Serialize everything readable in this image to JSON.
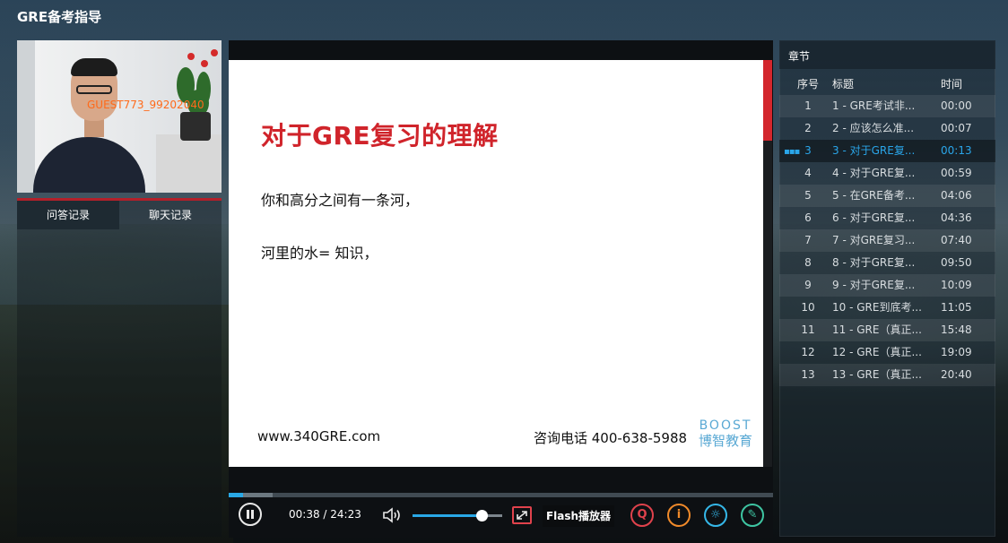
{
  "app": {
    "title": "GRE备考指导"
  },
  "webcam": {
    "guest_label": "GUEST773_99202040"
  },
  "left_tabs": [
    {
      "label": "问答记录",
      "active": true
    },
    {
      "label": "聊天记录",
      "active": false
    }
  ],
  "slide": {
    "title": "对于GRE复习的理解",
    "line1": "你和高分之间有一条河，",
    "line2": "河里的水= 知识，",
    "url": "www.340GRE.com",
    "phone": "咨询电话 400-638-5988",
    "logo_en": "BOOST",
    "logo_cn": "博智教育"
  },
  "player": {
    "current_time": "00:38",
    "total_time": "24:23",
    "time_display": "00:38 / 24:23",
    "progress_fraction": 0.026,
    "buffer_fraction": 0.08,
    "volume_fraction": 0.77,
    "flash_label": "Flash播放器",
    "pause_icon": "pause-icon",
    "accent_color": "#29a8e6"
  },
  "tools": [
    {
      "name": "qa-icon",
      "glyph": "Q",
      "color": "#e0424c"
    },
    {
      "name": "info-icon",
      "glyph": "i",
      "color": "#f08a2a"
    },
    {
      "name": "brightness-icon",
      "glyph": "☼",
      "color": "#35b7e8"
    },
    {
      "name": "edit-icon",
      "glyph": "✎",
      "color": "#3ec5a2"
    }
  ],
  "chapters": {
    "title": "章节",
    "headers": {
      "num": "序号",
      "title": "标题",
      "time": "时间"
    },
    "active_index": 2,
    "items": [
      {
        "num": "1",
        "title": "1 - GRE考试非...",
        "time": "00:00"
      },
      {
        "num": "2",
        "title": "2 - 应该怎么准...",
        "time": "00:07"
      },
      {
        "num": "3",
        "title": "3 - 对于GRE复...",
        "time": "00:13"
      },
      {
        "num": "4",
        "title": "4 - 对于GRE复...",
        "time": "00:59"
      },
      {
        "num": "5",
        "title": "5 - 在GRE备考...",
        "time": "04:06"
      },
      {
        "num": "6",
        "title": "6 - 对于GRE复...",
        "time": "04:36"
      },
      {
        "num": "7",
        "title": "7 - 对GRE复习...",
        "time": "07:40"
      },
      {
        "num": "8",
        "title": "8 - 对于GRE复...",
        "time": "09:50"
      },
      {
        "num": "9",
        "title": "9 - 对于GRE复...",
        "time": "10:09"
      },
      {
        "num": "10",
        "title": "10 - GRE到底考...",
        "time": "11:05"
      },
      {
        "num": "11",
        "title": "11 - GRE（真正...",
        "time": "15:48"
      },
      {
        "num": "12",
        "title": "12 - GRE（真正...",
        "time": "19:09"
      },
      {
        "num": "13",
        "title": "13 - GRE（真正...",
        "time": "20:40"
      }
    ]
  }
}
